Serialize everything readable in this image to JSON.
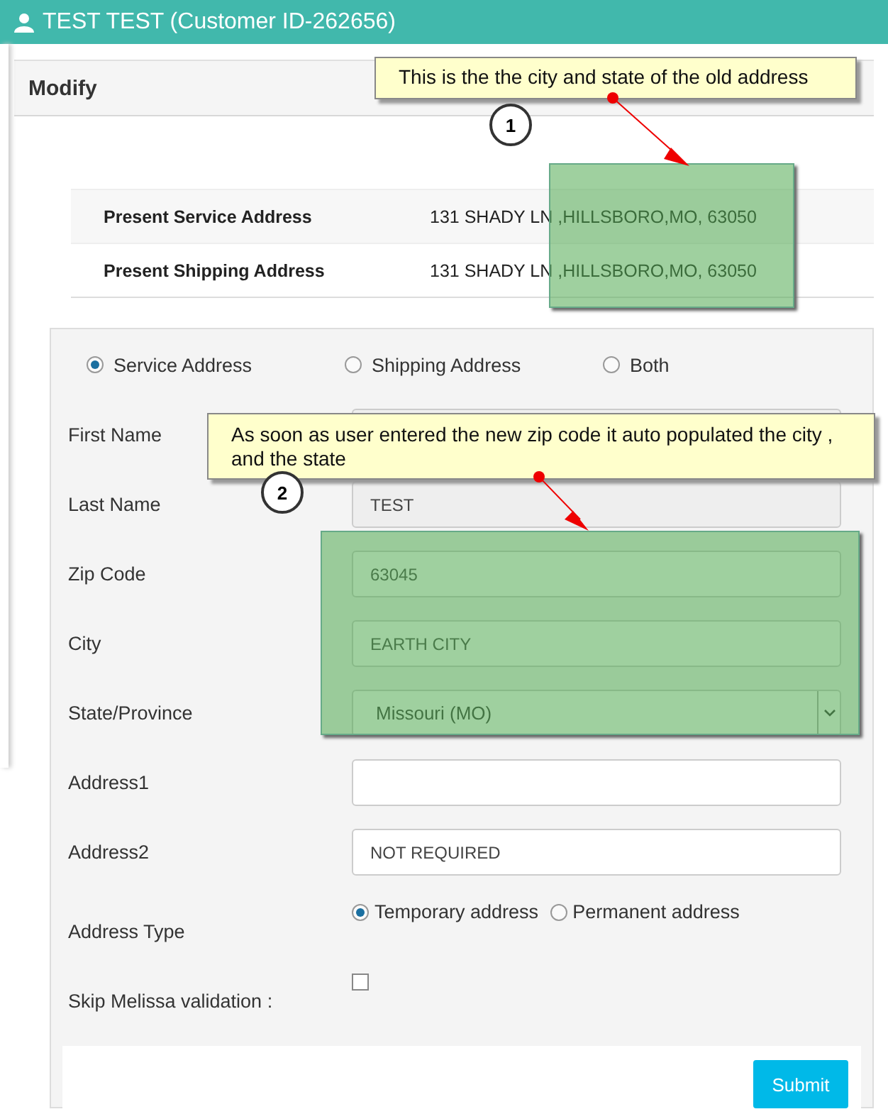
{
  "header": {
    "title": "TEST TEST (Customer ID-262656)"
  },
  "panel": {
    "title": "Modify"
  },
  "present": [
    {
      "label": "Present Service Address",
      "value": "131 SHADY LN ,HILLSBORO,MO, 63050"
    },
    {
      "label": "Present Shipping Address",
      "value": "131 SHADY LN ,HILLSBORO,MO, 63050"
    }
  ],
  "address_for": [
    {
      "label": "Service Address",
      "selected": true
    },
    {
      "label": "Shipping Address",
      "selected": false
    },
    {
      "label": "Both",
      "selected": false
    }
  ],
  "fields": [
    {
      "label": "First Name",
      "kind": "covered"
    },
    {
      "label": "Last Name",
      "kind": "text",
      "value": "TEST",
      "disabled": true
    },
    {
      "label": "Zip Code",
      "kind": "text",
      "value": "63045"
    },
    {
      "label": "City",
      "kind": "text",
      "value": "EARTH CITY"
    },
    {
      "label": "State/Province",
      "kind": "select",
      "value": "Missouri (MO)"
    },
    {
      "label": "Address1",
      "kind": "text",
      "disabled": false
    },
    {
      "label": "Address2",
      "kind": "text",
      "value": "NOT REQUIRED",
      "disabled": false
    },
    {
      "label": "Address Type",
      "kind": "radio",
      "options": [
        {
          "label": "Temporary address",
          "selected": true
        },
        {
          "label": "Permanent address",
          "selected": false
        }
      ]
    },
    {
      "label": "Skip Melissa validation :",
      "kind": "checkbox",
      "checked": false
    }
  ],
  "submit": "Submit",
  "annotations": [
    {
      "number": "1",
      "text": "This is the the city and state of the old address"
    },
    {
      "number": "2",
      "text": "As soon as user entered the new zip code it auto populated the city , and the state"
    }
  ]
}
